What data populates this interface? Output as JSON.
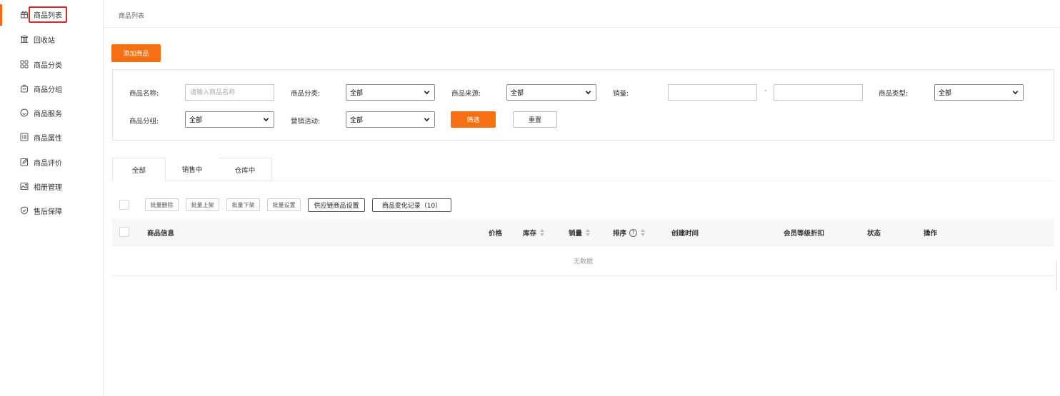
{
  "sidebar": {
    "items": [
      {
        "label": "商品列表",
        "icon": "gift-icon"
      },
      {
        "label": "回收站",
        "icon": "recycle-bin-icon"
      },
      {
        "label": "商品分类",
        "icon": "grid-icon"
      },
      {
        "label": "商品分组",
        "icon": "bag-icon"
      },
      {
        "label": "商品服务",
        "icon": "smile-icon"
      },
      {
        "label": "商品属性",
        "icon": "list-icon"
      },
      {
        "label": "商品评价",
        "icon": "edit-icon"
      },
      {
        "label": "相册管理",
        "icon": "image-icon"
      },
      {
        "label": "售后保障",
        "icon": "shield-icon"
      }
    ]
  },
  "breadcrumb": "商品列表",
  "add_button": "添加商品",
  "filters": {
    "name_label": "商品名称:",
    "name_placeholder": "请输入商品名称",
    "category_label": "商品分类:",
    "category_value": "全部",
    "source_label": "商品来源:",
    "source_value": "全部",
    "sales_label": "销量:",
    "sales_dash": "-",
    "type_label": "商品类型:",
    "type_value": "全部",
    "group_label": "商品分组:",
    "group_value": "全部",
    "marketing_label": "营销活动:",
    "marketing_value": "全部",
    "filter_button": "筛选",
    "reset_button": "重置"
  },
  "tabs": [
    "全部",
    "销售中",
    "仓库中"
  ],
  "batch": {
    "delete": "批量删除",
    "onshelf": "批量上架",
    "offshelf": "批量下架",
    "settings": "批量设置",
    "supply": "供应链商品设置",
    "changelog": "商品变化记录（10）"
  },
  "table": {
    "headers": {
      "info": "商品信息",
      "price": "价格",
      "stock": "库存",
      "sales": "销量",
      "sort": "排序",
      "created": "创建时间",
      "discount": "会员等级折扣",
      "status": "状态",
      "action": "操作"
    },
    "empty": "无数据"
  },
  "colors": {
    "accent": "#f57012",
    "highlight_box": "#d32a2a"
  }
}
